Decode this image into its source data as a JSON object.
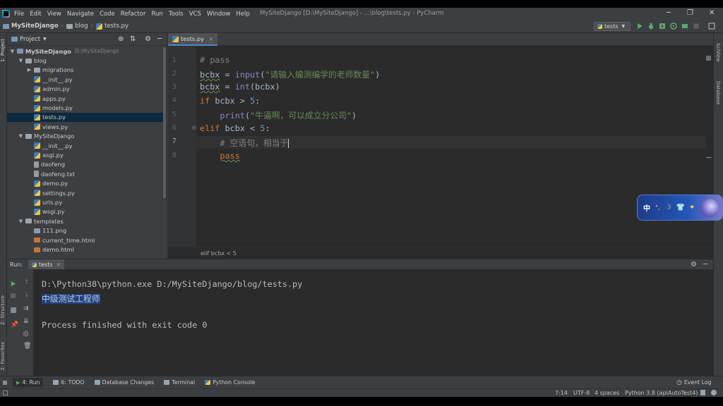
{
  "menubar": {
    "items": [
      "File",
      "Edit",
      "View",
      "Navigate",
      "Code",
      "Refactor",
      "Run",
      "Tools",
      "VCS",
      "Window",
      "Help"
    ],
    "window_title": "MySiteDjango [D:\\MySiteDjango] - ...\\blog\\tests.py - PyCharm"
  },
  "navbar": {
    "project": "MySiteDjango",
    "folder": "blog",
    "file": "tests.py",
    "run_config": "tests"
  },
  "left_strip": {
    "project_label": "1: Project",
    "structure_label": "Z: Structure",
    "favorites_label": "2: Favorites"
  },
  "right_strip": {
    "scview_label": "SciView",
    "database_label": "Database"
  },
  "project_panel": {
    "title": "Project",
    "tree": [
      {
        "label": "MySiteDjango",
        "suffix": "D:\\MySiteDjango",
        "type": "root",
        "depth": 0,
        "arrow": "▼"
      },
      {
        "label": "blog",
        "type": "folder",
        "depth": 1,
        "arrow": "▼"
      },
      {
        "label": "migrations",
        "type": "folder",
        "depth": 2,
        "arrow": "▶"
      },
      {
        "label": "__init__.py",
        "type": "py",
        "depth": 2
      },
      {
        "label": "admin.py",
        "type": "py",
        "depth": 2
      },
      {
        "label": "apps.py",
        "type": "py",
        "depth": 2
      },
      {
        "label": "models.py",
        "type": "py",
        "depth": 2
      },
      {
        "label": "tests.py",
        "type": "py",
        "depth": 2,
        "selected": true
      },
      {
        "label": "views.py",
        "type": "py",
        "depth": 2
      },
      {
        "label": "MySiteDjango",
        "type": "folder",
        "depth": 1,
        "arrow": "▼"
      },
      {
        "label": "__init__.py",
        "type": "py",
        "depth": 2
      },
      {
        "label": "asgi.py",
        "type": "py",
        "depth": 2
      },
      {
        "label": "daofeng",
        "type": "file",
        "depth": 2
      },
      {
        "label": "daofeng.txt",
        "type": "file",
        "depth": 2
      },
      {
        "label": "demo.py",
        "type": "py",
        "depth": 2
      },
      {
        "label": "settings.py",
        "type": "py",
        "depth": 2
      },
      {
        "label": "urls.py",
        "type": "py",
        "depth": 2
      },
      {
        "label": "wsgi.py",
        "type": "py",
        "depth": 2
      },
      {
        "label": "templates",
        "type": "folder",
        "depth": 1,
        "arrow": "▼"
      },
      {
        "label": "111.png",
        "type": "img",
        "depth": 2
      },
      {
        "label": "current_time.html",
        "type": "html",
        "depth": 2
      },
      {
        "label": "demo.html",
        "type": "html",
        "depth": 2
      }
    ]
  },
  "editor": {
    "tab": "tests.py",
    "line_numbers": [
      "1",
      "2",
      "3",
      "4",
      "5",
      "6",
      "7",
      "8"
    ],
    "current_line": 7,
    "breadcrumb": "elif bcbx < 5"
  },
  "run_panel": {
    "label": "Run:",
    "tab": "tests",
    "output": [
      "D:\\Python38\\python.exe D:/MySiteDjango/blog/tests.py",
      "中级测试工程师",
      "",
      "Process finished with exit code 0"
    ]
  },
  "bottom_tabs": {
    "run": "4: Run",
    "todo": "6: TODO",
    "db_changes": "Database Changes",
    "terminal": "Terminal",
    "python_console": "Python Console",
    "event_log": "Event Log"
  },
  "statusbar": {
    "position": "7:14",
    "encoding": "UTF-8",
    "indent": "4 spaces",
    "interpreter": "Python 3.8 (apiAutoTest4)"
  },
  "ime": {
    "char": "中"
  },
  "colors": {
    "keyword": "#cc7832",
    "string": "#6a8759",
    "comment": "#808080",
    "number": "#6897bb",
    "builtin": "#8888c6",
    "selection": "#214283"
  }
}
